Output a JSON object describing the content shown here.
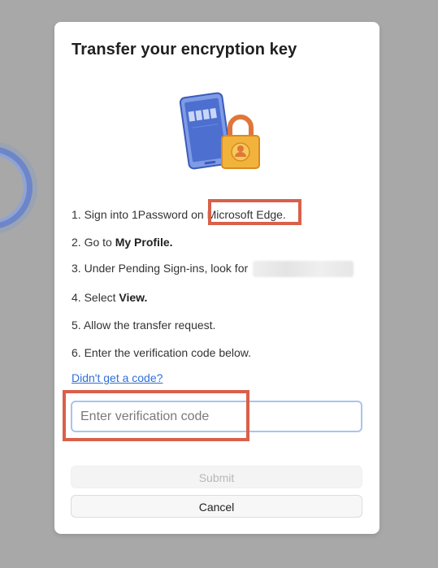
{
  "dialog": {
    "title": "Transfer your encryption key",
    "steps": [
      {
        "number": "1.",
        "text": "Sign into 1Password on ",
        "bold": "",
        "emphasis": "Microsoft Edge."
      },
      {
        "number": "2.",
        "text": "Go to ",
        "bold": "My Profile."
      },
      {
        "number": "3.",
        "text": "Under Pending Sign-ins, look for",
        "bold": ""
      },
      {
        "number": "4.",
        "text": "Select ",
        "bold": "View."
      },
      {
        "number": "5.",
        "text": "Allow the transfer request.",
        "bold": ""
      },
      {
        "number": "6.",
        "text": "Enter the verification code below.",
        "bold": ""
      }
    ],
    "help_link": "Didn't get a code?",
    "code_input": {
      "placeholder": "Enter verification code",
      "value": ""
    },
    "submit_label": "Submit",
    "cancel_label": "Cancel"
  },
  "icons": {
    "illustration": "tablet-lock-icon"
  },
  "colors": {
    "annotation_red": "#d9604a",
    "link_blue": "#2f6fd8",
    "input_focus_border": "#a9c4ef",
    "lock_orange": "#e0763a",
    "lock_yellow": "#f1b33b",
    "tablet_blue": "#5b7fd6"
  }
}
